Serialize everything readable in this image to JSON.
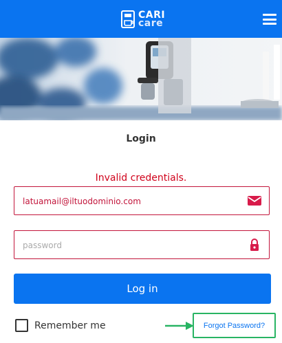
{
  "header": {
    "brand_line1": "CARI",
    "brand_line2": "care",
    "icons": {
      "logo": "device-logo-icon",
      "menu": "hamburger-menu-icon"
    },
    "color": "#0a74f0"
  },
  "hero": {
    "icon": "espresso-machine-photo"
  },
  "login": {
    "title": "Login",
    "error": "Invalid credentials.",
    "email_placeholder": "latuamail@iltuodominio.com",
    "email_value": "latuamail@iltuodominio.com",
    "password_placeholder": "password",
    "password_value": "",
    "submit_label": "Log in",
    "remember_label": "Remember me",
    "remember_checked": false,
    "forgot_label": "Forgot Password?",
    "error_color": "#d0021b",
    "field_icons": {
      "email": "envelope-icon",
      "password": "lock-icon"
    }
  },
  "annotation": {
    "highlight_color": "#28b463",
    "arrow": "arrow-right-icon"
  }
}
